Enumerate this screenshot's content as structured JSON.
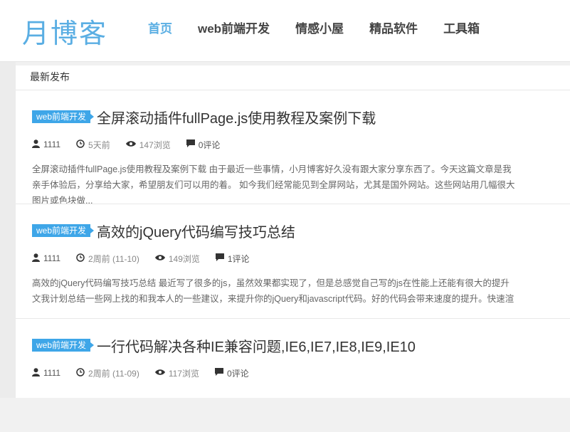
{
  "logo": "月博客",
  "nav": [
    {
      "label": "首页",
      "active": true
    },
    {
      "label": "web前端开发",
      "active": false
    },
    {
      "label": "情感小屋",
      "active": false
    },
    {
      "label": "精品软件",
      "active": false
    },
    {
      "label": "工具箱",
      "active": false
    }
  ],
  "section_title": "最新发布",
  "posts": [
    {
      "category": "web前端开发",
      "title": "全屏滚动插件fullPage.js使用教程及案例下载",
      "author": "1111",
      "time": "5天前",
      "views": "147浏览",
      "comments": "0评论",
      "excerpt_lines": [
        "全屏滚动插件fullPage.js使用教程及案例下载 由于最近一些事情，小月博客好久没有跟大家分享东西了。今天这篇文章是我",
        "亲手体验后，分享给大家，希望朋友们可以用的着。 如今我们经常能见到全屏网站，尤其是国外网站。这些网站用几幅很大",
        "图片或色块做..."
      ]
    },
    {
      "category": "web前端开发",
      "title": "高效的jQuery代码编写技巧总结",
      "author": "1111",
      "time": "2周前 (11-10)",
      "views": "149浏览",
      "comments": "1评论",
      "excerpt_lines": [
        "高效的jQuery代码编写技巧总结 最近写了很多的js，虽然效果都实现了，但是总感觉自己写的js在性能上还能有很大的提升",
        "文我计划总结一些网上找的和我本人的一些建议，来提升你的jQuery和javascript代码。好的代码会带来速度的提升。快速渲"
      ]
    },
    {
      "category": "web前端开发",
      "title": "一行代码解决各种IE兼容问题,IE6,IE7,IE8,IE9,IE10",
      "author": "1111",
      "time": "2周前 (11-09)",
      "views": "117浏览",
      "comments": "0评论",
      "excerpt_lines": []
    }
  ]
}
